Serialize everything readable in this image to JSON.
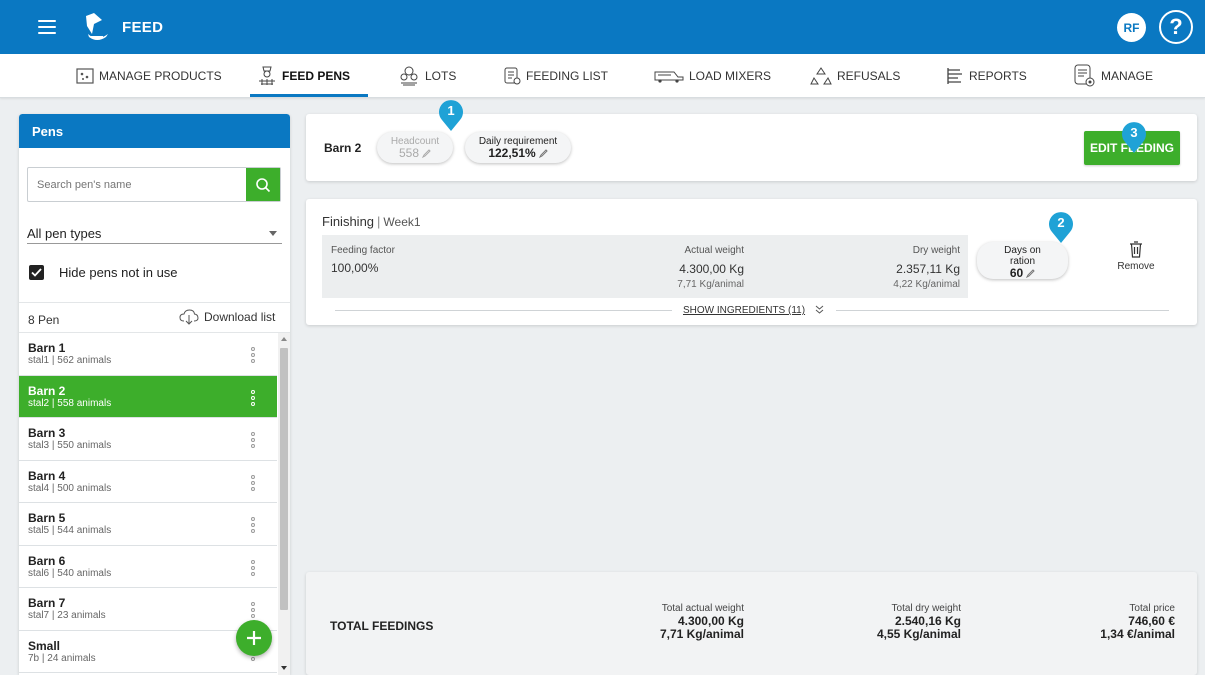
{
  "header": {
    "brand": "FEED",
    "user_initials": "RF",
    "help": "?"
  },
  "nav": [
    {
      "label": "MANAGE PRODUCTS",
      "icon": "products-icon"
    },
    {
      "label": "FEED PENS",
      "icon": "feed-pens-icon",
      "active": true
    },
    {
      "label": "LOTS",
      "icon": "lots-icon"
    },
    {
      "label": "FEEDING LIST",
      "icon": "feeding-list-icon"
    },
    {
      "label": "LOAD MIXERS",
      "icon": "mixer-truck-icon"
    },
    {
      "label": "REFUSALS",
      "icon": "recycle-icon"
    },
    {
      "label": "REPORTS",
      "icon": "reports-icon"
    },
    {
      "label": "MANAGE",
      "icon": "manage-icon"
    }
  ],
  "pens": {
    "title": "Pens",
    "search_placeholder": "Search pen's name",
    "filter": "All pen types",
    "hide_label": "Hide pens not in use",
    "count": "8 Pen",
    "download": "Download list",
    "items": [
      {
        "name": "Barn 1",
        "sub": "stal1 | 562 animals"
      },
      {
        "name": "Barn 2",
        "sub": "stal2 | 558 animals",
        "selected": true
      },
      {
        "name": "Barn 3",
        "sub": "stal3 | 550 animals"
      },
      {
        "name": "Barn 4",
        "sub": "stal4 | 500 animals"
      },
      {
        "name": "Barn 5",
        "sub": "stal5 | 544 animals"
      },
      {
        "name": "Barn 6",
        "sub": "stal6 | 540 animals"
      },
      {
        "name": "Barn 7",
        "sub": "stal7 | 23 animals"
      },
      {
        "name": "Small",
        "sub": "7b | 24 animals"
      }
    ]
  },
  "barn": {
    "title": "Barn 2",
    "headcount_label": "Headcount",
    "headcount": "558",
    "daily_label": "Daily requirement",
    "daily": "122,51%",
    "edit": "EDIT FEEDING"
  },
  "badges": [
    "1",
    "2",
    "3"
  ],
  "feeding": {
    "name": "Finishing",
    "week": "Week1",
    "factor_label": "Feeding factor",
    "factor": "100,00%",
    "actual_label": "Actual weight",
    "actual": "4.300,00 Kg",
    "actual_per": "7,71 Kg/animal",
    "dry_label": "Dry weight",
    "dry": "2.357,11 Kg",
    "dry_per": "4,22 Kg/animal",
    "days_label_1": "Days on",
    "days_label_2": "ration",
    "days": "60",
    "remove": "Remove",
    "show_ingredients": "SHOW INGREDIENTS (11)"
  },
  "totals": {
    "title": "TOTAL FEEDINGS",
    "actual_label": "Total actual weight",
    "actual": "4.300,00 Kg",
    "actual_per": "7,71 Kg/animal",
    "dry_label": "Total dry weight",
    "dry": "2.540,16 Kg",
    "dry_per": "4,55 Kg/animal",
    "price_label": "Total price",
    "price": "746,60 €",
    "price_per": "1,34 €/animal"
  },
  "colors": {
    "primary": "#0a78c2",
    "accent": "#3dae2b",
    "badge": "#1fa2d6"
  }
}
